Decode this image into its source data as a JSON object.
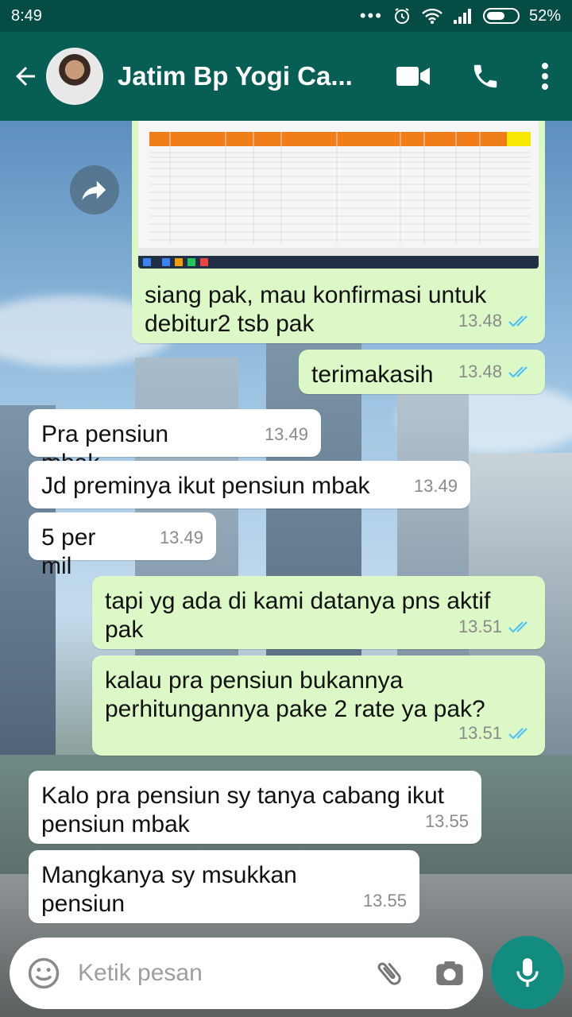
{
  "status_bar": {
    "time": "8:49",
    "battery": "52%"
  },
  "header": {
    "title": "Jatim Bp Yogi Ca..."
  },
  "messages": [
    {
      "dir": "out",
      "text": "siang pak, mau konfirmasi untuk debitur2 tsb pak",
      "time": "13.48"
    },
    {
      "dir": "out",
      "text": "terimakasih",
      "time": "13.48"
    },
    {
      "dir": "in",
      "text": "Pra pensiun mbak",
      "time": "13.49"
    },
    {
      "dir": "in",
      "text": "Jd preminya ikut pensiun mbak",
      "time": "13.49"
    },
    {
      "dir": "in",
      "text": "5 per mil",
      "time": "13.49"
    },
    {
      "dir": "out",
      "text": "tapi yg ada di kami datanya pns aktif pak",
      "time": "13.51"
    },
    {
      "dir": "out",
      "text": "kalau pra pensiun bukannya perhitungannya pake 2 rate ya pak?",
      "time": "13.51"
    },
    {
      "dir": "in",
      "text": "Kalo pra pensiun sy tanya cabang ikut pensiun mbak",
      "time": "13.55"
    },
    {
      "dir": "in",
      "text": "Mangkanya sy msukkan pensiun",
      "time": "13.55"
    }
  ],
  "composer": {
    "placeholder": "Ketik pesan"
  },
  "icons": {
    "back": "arrow-left-icon",
    "video": "video-call-icon",
    "call": "phone-icon",
    "menu": "more-vert-icon",
    "share": "forward-icon",
    "emoji": "emoji-icon",
    "attach": "paperclip-icon",
    "camera": "camera-icon",
    "mic": "microphone-icon"
  },
  "colors": {
    "header": "#075e54",
    "statusbar": "#054d44",
    "outgoing": "#dcf8c6",
    "incoming": "#ffffff",
    "tick": "#4fc3f7",
    "fab": "#128c7e"
  }
}
